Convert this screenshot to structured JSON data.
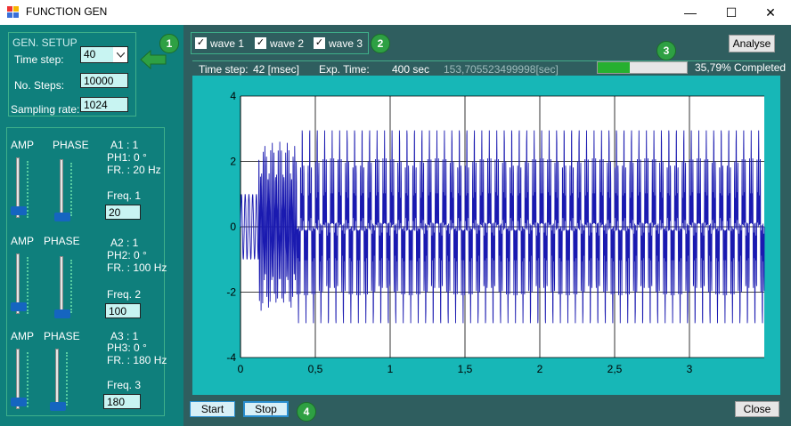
{
  "window": {
    "title": "FUNCTION GEN",
    "minimize": "—",
    "maximize": "☐",
    "close": "✕"
  },
  "gen_setup": {
    "title": "GEN. SETUP",
    "time_step_label": "Time step:",
    "time_step_value": "40",
    "steps_label": "No. Steps:",
    "steps_value": "10000",
    "sampling_label": "Sampling rate:",
    "sampling_value": "1024"
  },
  "waves": [
    {
      "amp_label": "AMP",
      "phase_label": "PHASE",
      "amp_text": "A1 : 1",
      "ph_text": "PH1: 0 °",
      "fr_text": "FR. : 20 Hz",
      "freq_label": "Freq. 1",
      "freq_value": "20"
    },
    {
      "amp_label": "AMP",
      "phase_label": "PHASE",
      "amp_text": "A2 : 1",
      "ph_text": "PH2: 0 °",
      "fr_text": "FR. : 100 Hz",
      "freq_label": "Freq. 2",
      "freq_value": "100"
    },
    {
      "amp_label": "AMP",
      "phase_label": "PHASE",
      "amp_text": "A3 : 1",
      "ph_text": "PH3: 0 °",
      "fr_text": "FR. : 180 Hz",
      "freq_label": "Freq. 3",
      "freq_value": "180"
    }
  ],
  "checkboxes": [
    {
      "label": "wave 1",
      "checked": "✓"
    },
    {
      "label": "wave 2",
      "checked": "✓"
    },
    {
      "label": "wave 3",
      "checked": "✓"
    }
  ],
  "badges": [
    "1",
    "2",
    "3",
    "4"
  ],
  "status": {
    "time_step": "Time step:",
    "time_step_value": "42 [msec]",
    "exp_time": "Exp. Time:",
    "exp_time_value": "400 sec",
    "elapsed": "153,705523499998[sec]",
    "progress_fraction": 0.3579,
    "progress_text": "35,79% Completed"
  },
  "buttons": {
    "analyse": "Analyse",
    "start": "Start",
    "stop": "Stop",
    "close": "Close"
  },
  "chart_data": {
    "type": "line",
    "x_ticks": [
      "0",
      "0,5",
      "1",
      "1,5",
      "2",
      "2,5",
      "3"
    ],
    "y_ticks": [
      "4",
      "2",
      "0",
      "-2",
      "-4"
    ],
    "xlim": [
      0,
      3.5
    ],
    "ylim": [
      -4,
      4
    ],
    "grid": true,
    "line_color": "#1a1ab0"
  }
}
